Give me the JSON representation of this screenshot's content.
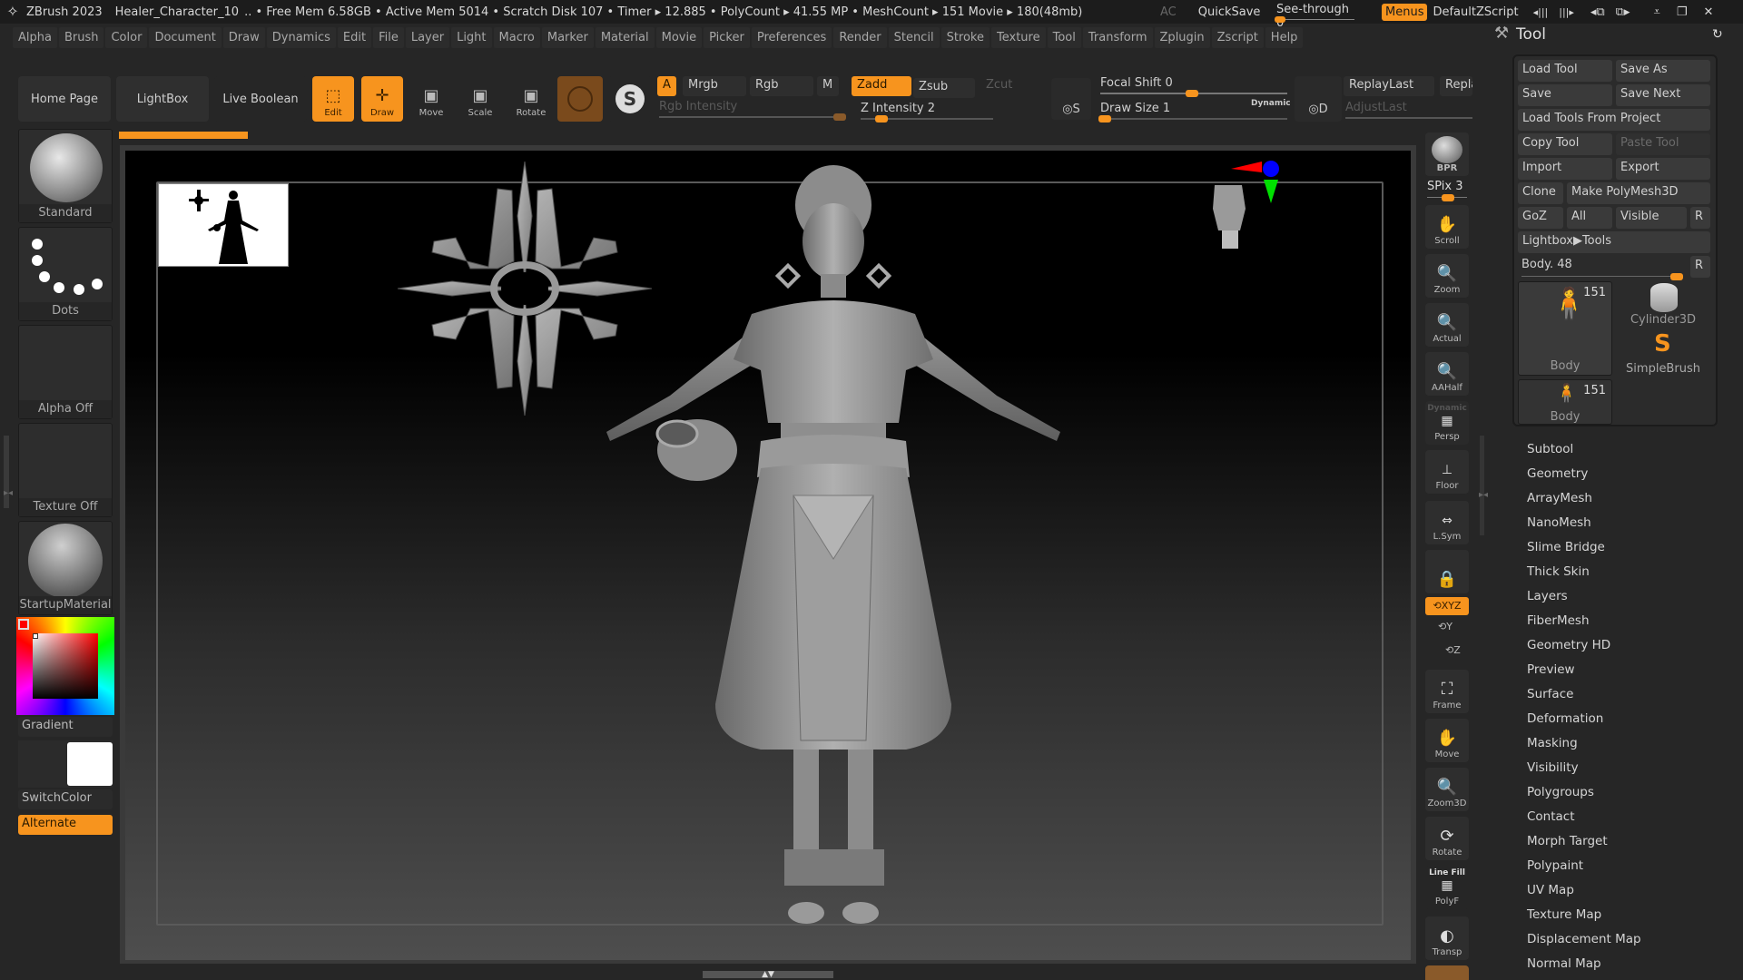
{
  "titlebar": {
    "app": "ZBrush 2023",
    "document": "Healer_Character_10",
    "stats": ".. • Free Mem 6.58GB • Active Mem 5014 • Scratch Disk 107 •  Timer ▸ 12.885 • PolyCount ▸ 41.55 MP  • MeshCount ▸ 151  Movie ▸ 180(48mb)",
    "ac": "AC",
    "quicksave": "QuickSave",
    "see_through_label": "See-through  0",
    "see_through_value": 0,
    "menus": "Menus",
    "default_zscript": "DefaultZScript",
    "icons": [
      "ui-layout-prev-icon",
      "ui-layout-next-icon",
      "window-layout-icon",
      "window-layout-alt-icon",
      "minimize-icon",
      "restore-icon",
      "close-icon"
    ]
  },
  "menubar": [
    "Alpha",
    "Brush",
    "Color",
    "Document",
    "Draw",
    "Dynamics",
    "Edit",
    "File",
    "Layer",
    "Light",
    "Macro",
    "Marker",
    "Material",
    "Movie",
    "Picker",
    "Preferences",
    "Render",
    "Stencil",
    "Stroke",
    "Texture",
    "Tool",
    "Transform",
    "Zplugin",
    "Zscript",
    "Help"
  ],
  "toolbar": {
    "home_page": "Home Page",
    "lightbox": "LightBox",
    "live_boolean": "Live Boolean",
    "edit": "Edit",
    "draw": "Draw",
    "move": "Move",
    "scale": "Scale",
    "rotate": "Rotate",
    "a": "A",
    "mrgb": "Mrgb",
    "rgb": "Rgb",
    "m": "M",
    "zadd": "Zadd",
    "zsub": "Zsub",
    "zcut": "Zcut",
    "rgb_intensity": "Rgb Intensity",
    "z_intensity": "Z Intensity 2",
    "z_intensity_value": 2,
    "focal_shift": "Focal Shift 0",
    "focal_shift_value": 0,
    "draw_size": "Draw Size 1",
    "draw_size_value": 1,
    "dynamic": "Dynamic",
    "replay_last": "ReplayLast",
    "replay_last_rel": "Repla",
    "adjust_last": "AdjustLast",
    "lazy_s": "S",
    "lazy_d": "D"
  },
  "left_shelf": {
    "brush": "Standard",
    "stroke": "Dots",
    "alpha": "Alpha Off",
    "texture": "Texture Off",
    "material": "StartupMaterial",
    "gradient": "Gradient",
    "switch_color": "SwitchColor",
    "alternate": "Alternate",
    "main_color": "#ff0000",
    "secondary_color": "#ffffff"
  },
  "right_shelf": {
    "bpr": "BPR",
    "spix": "SPix 3",
    "scroll": "Scroll",
    "zoom": "Zoom",
    "actual": "Actual",
    "aahalf": "AAHalf",
    "dynamic": "Dynamic",
    "persp": "Persp",
    "floor": "Floor",
    "lsym": "L.Sym",
    "xyz": "XYZ",
    "y": "Y",
    "z": "Z",
    "frame": "Frame",
    "move": "Move",
    "zoom3d": "Zoom3D",
    "rotate": "Rotate",
    "line_fill": "Line Fill",
    "polyf": "PolyF",
    "transp": "Transp"
  },
  "tool_panel": {
    "title": "Tool",
    "load_tool": "Load Tool",
    "save_as": "Save As",
    "save": "Save",
    "save_next": "Save Next",
    "load_tools_from_project": "Load Tools From Project",
    "copy_tool": "Copy Tool",
    "paste_tool": "Paste Tool",
    "import": "Import",
    "export": "Export",
    "clone": "Clone",
    "make_polymesh3d": "Make PolyMesh3D",
    "goz": "GoZ",
    "all": "All",
    "visible": "Visible",
    "r": "R",
    "lightbox_tools": "Lightbox▶Tools",
    "current_tool": "Body. 48",
    "current_tool_value": 48,
    "thumbs": [
      {
        "name": "Body",
        "count": "151"
      },
      {
        "name": "Cylinder3D",
        "count": ""
      },
      {
        "name": "SimpleBrush",
        "count": ""
      },
      {
        "name": "Body",
        "count": "151"
      }
    ],
    "subpalettes": [
      "Subtool",
      "Geometry",
      "ArrayMesh",
      "NanoMesh",
      "Slime Bridge",
      "Thick Skin",
      "Layers",
      "FiberMesh",
      "Geometry HD",
      "Preview",
      "Surface",
      "Deformation",
      "Masking",
      "Visibility",
      "Polygroups",
      "Contact",
      "Morph Target",
      "Polypaint",
      "UV Map",
      "Texture Map",
      "Displacement Map",
      "Normal Map"
    ]
  },
  "colors": {
    "accent": "#f7941e",
    "panel": "#262626",
    "axis_x": "#ff0000",
    "axis_y": "#00e000",
    "axis_z": "#0000ff"
  }
}
